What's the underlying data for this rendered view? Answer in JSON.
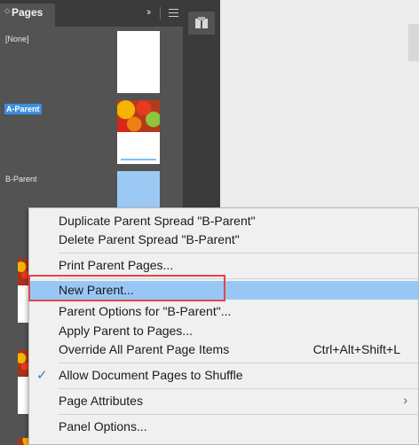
{
  "panel": {
    "tab_label": "Pages",
    "tab_arrows": "⬦",
    "collapse_glyph": "››",
    "parents": [
      {
        "label": "[None]"
      },
      {
        "label": "A-Parent"
      },
      {
        "label": "B-Parent"
      }
    ]
  },
  "context_menu": {
    "items": [
      {
        "label": "Duplicate Parent Spread \"B-Parent\""
      },
      {
        "label": "Delete Parent Spread \"B-Parent\""
      },
      {
        "label": "Print Parent Pages..."
      },
      {
        "label": "New Parent..."
      },
      {
        "label": "Parent Options for \"B-Parent\"..."
      },
      {
        "label": "Apply Parent to Pages..."
      },
      {
        "label": "Override All Parent Page Items",
        "shortcut": "Ctrl+Alt+Shift+L"
      },
      {
        "label": "Allow Document Pages to Shuffle",
        "checked": true
      },
      {
        "label": "Page Attributes",
        "submenu": true
      },
      {
        "label": "Panel Options..."
      }
    ],
    "check_glyph": "✓",
    "submenu_glyph": "›"
  },
  "colors": {
    "highlight": "#99c7f5",
    "focus_outline": "#e2464b",
    "selected_label": "#3a8fe0"
  }
}
